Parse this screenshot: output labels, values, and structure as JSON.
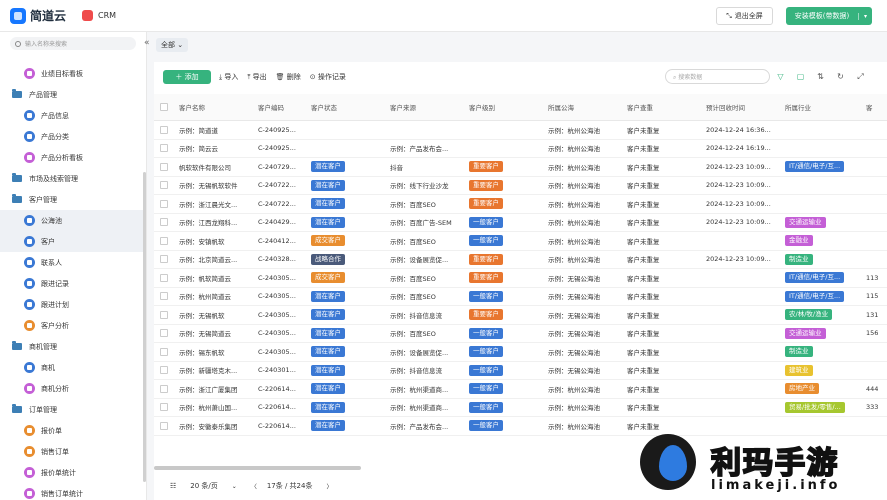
{
  "header": {
    "brand": "简道云",
    "app_name": "CRM",
    "fullscreen_label": "退出全屏",
    "install_label": "安装模板(带数据)",
    "install_dropdown": "▾"
  },
  "sidebar": {
    "search_placeholder": "输入名称来搜索",
    "collapse": "«",
    "items": [
      {
        "label": "业绩目标看板",
        "type": "sub",
        "color": "#c45fd6"
      },
      {
        "label": "产品管理",
        "type": "group"
      },
      {
        "label": "产品信息",
        "type": "sub",
        "color": "#3a78d4"
      },
      {
        "label": "产品分类",
        "type": "sub",
        "color": "#3a78d4"
      },
      {
        "label": "产品分析看板",
        "type": "sub",
        "color": "#c45fd6"
      },
      {
        "label": "市场及线索管理",
        "type": "group"
      },
      {
        "label": "客户管理",
        "type": "group"
      },
      {
        "label": "公海池",
        "type": "sub",
        "color": "#3a78d4",
        "active": true
      },
      {
        "label": "客户",
        "type": "sub",
        "color": "#3a78d4",
        "active": true
      },
      {
        "label": "联系人",
        "type": "sub",
        "color": "#3a78d4"
      },
      {
        "label": "跟进记录",
        "type": "sub",
        "color": "#3a78d4"
      },
      {
        "label": "跟进计划",
        "type": "sub",
        "color": "#3a78d4"
      },
      {
        "label": "客户分析",
        "type": "sub",
        "color": "#e88d2f"
      },
      {
        "label": "商机管理",
        "type": "group"
      },
      {
        "label": "商机",
        "type": "sub",
        "color": "#3a78d4"
      },
      {
        "label": "商机分析",
        "type": "sub",
        "color": "#c45fd6"
      },
      {
        "label": "订单管理",
        "type": "group"
      },
      {
        "label": "报价单",
        "type": "sub",
        "color": "#e88d2f"
      },
      {
        "label": "销售订单",
        "type": "sub",
        "color": "#e88d2f"
      },
      {
        "label": "报价单统计",
        "type": "sub",
        "color": "#c45fd6"
      },
      {
        "label": "销售订单统计",
        "type": "sub",
        "color": "#c45fd6"
      }
    ]
  },
  "filter": {
    "label": "全部",
    "chevron": "⌄"
  },
  "toolbar": {
    "add": "＋ 添加",
    "import": "⤓ 导入",
    "export": "⤒ 导出",
    "delete": "🗑 删除",
    "log": "⊙ 操作记录",
    "search_placeholder": "⌕ 搜索数据"
  },
  "toolbar_icons": [
    "filter-icon",
    "comment-icon",
    "sort-icon",
    "refresh-icon",
    "expand-icon"
  ],
  "toolbar_icon_glyphs": [
    "▽",
    "▢",
    "⇅",
    "↻",
    "⤢"
  ],
  "table": {
    "columns": [
      "客户名称",
      "客户编码",
      "客户状态",
      "客户来源",
      "客户级别",
      "所属公海",
      "客户查重",
      "预计回收时间",
      "所属行业",
      "客"
    ],
    "rows": [
      [
        "示例：简道道",
        "C-240925...",
        "",
        "",
        "",
        "示例：杭州公海池",
        "客户未重复",
        "2024-12-24 16:36...",
        "",
        ""
      ],
      [
        "示例：简云云",
        "C-240925...",
        "",
        "示例：产品发布会...",
        "",
        "示例：杭州公海池",
        "客户未重复",
        "2024-12-24 16:19...",
        "",
        ""
      ],
      [
        "帆软软件有限公司",
        "C-240729...",
        "潜在客户",
        "抖音",
        "重要客户",
        "示例：杭州公海池",
        "客户未重复",
        "2024-12-23 10:09...",
        "IT/通信/电子/互...",
        ""
      ],
      [
        "示例：无锡帆软软件",
        "C-240722...",
        "潜在客户",
        "示例：线下行业沙龙",
        "重要客户",
        "示例：杭州公海池",
        "客户未重复",
        "2024-12-23 10:09...",
        "",
        ""
      ],
      [
        "示例：浙江晨光文...",
        "C-240722...",
        "潜在客户",
        "示例：百度SEO",
        "重要客户",
        "示例：杭州公海池",
        "客户未重复",
        "2024-12-23 10:09...",
        "",
        ""
      ],
      [
        "示例：江西龙翔科...",
        "C-240429...",
        "潜在客户",
        "示例：百度广告-SEM",
        "一般客户",
        "示例：杭州公海池",
        "客户未重复",
        "2024-12-23 10:09...",
        "交通运输业",
        ""
      ],
      [
        "示例：安镇帆软",
        "C-240412...",
        "成交客户",
        "示例：百度SEO",
        "一般客户",
        "示例：杭州公海池",
        "客户未重复",
        "",
        "金融业",
        ""
      ],
      [
        "示例：北京简道云...",
        "C-240328...",
        "战略合作",
        "示例：设备展览促...",
        "重要客户",
        "示例：杭州公海池",
        "客户未重复",
        "2024-12-23 10:09...",
        "制造业",
        ""
      ],
      [
        "示例：帆软简道云",
        "C-240305...",
        "成交客户",
        "示例：百度SEO",
        "重要客户",
        "示例：无锡公海池",
        "客户未重复",
        "",
        "IT/通信/电子/互...",
        "113"
      ],
      [
        "示例：杭州简道云",
        "C-240305...",
        "潜在客户",
        "示例：百度SEO",
        "一般客户",
        "示例：无锡公海池",
        "客户未重复",
        "",
        "IT/通信/电子/互...",
        "115"
      ],
      [
        "示例：无锡帆软",
        "C-240305...",
        "潜在客户",
        "示例：抖音信息流",
        "重要客户",
        "示例：无锡公海池",
        "客户未重复",
        "",
        "农/林/牧/渔业",
        "131"
      ],
      [
        "示例：无锡简道云",
        "C-240305...",
        "潜在客户",
        "示例：百度SEO",
        "一般客户",
        "示例：无锡公海池",
        "客户未重复",
        "",
        "交通运输业",
        "156"
      ],
      [
        "示例：锡东帆软",
        "C-240305...",
        "潜在客户",
        "示例：设备展览促...",
        "一般客户",
        "示例：无锡公海池",
        "客户未重复",
        "",
        "制造业",
        ""
      ],
      [
        "示例：新疆塔克木...",
        "C-240301...",
        "潜在客户",
        "示例：抖音信息流",
        "一般客户",
        "示例：无锡公海池",
        "客户未重复",
        "",
        "建筑业",
        ""
      ],
      [
        "示例：浙江广厦集团",
        "C-220614...",
        "潜在客户",
        "示例：杭州渠道商...",
        "一般客户",
        "示例：杭州公海池",
        "客户未重复",
        "",
        "房地产业",
        "444"
      ],
      [
        "示例：杭州萧山国...",
        "C-220614...",
        "潜在客户",
        "示例：杭州渠道商...",
        "一般客户",
        "示例：杭州公海池",
        "客户未重复",
        "",
        "贸易/批发/零售/...",
        "333"
      ],
      [
        "示例：安徽泰乐集团",
        "C-220614...",
        "潜在客户",
        "示例：产品发布会...",
        "一般客户",
        "示例：杭州公海池",
        "客户未重复",
        "",
        "",
        ""
      ]
    ]
  },
  "tag_colors": {
    "潜在客户": "#3a78d4",
    "成交客户": "#e88d2f",
    "战略合作": "#4a5a7a",
    "重要客户": "#e8762f",
    "一般客户": "#3a78d4",
    "IT/通信/电子/互...": "#3a78d4",
    "交通运输业": "#c45fd6",
    "金融业": "#c45fd6",
    "制造业": "#36b37e",
    "农/林/牧/渔业": "#36b37e",
    "建筑业": "#e8c22f",
    "房地产业": "#e88d2f",
    "贸易/批发/零售/...": "#a6c72f"
  },
  "pager": {
    "page_size_icon": "☷",
    "page_size": "20 条/页",
    "dropdown": "⌄",
    "summary": "17条 / 共24条",
    "prev": "〈",
    "next": "〉"
  },
  "watermark": {
    "text": "利玛手游",
    "sub": "limakeji.info"
  }
}
